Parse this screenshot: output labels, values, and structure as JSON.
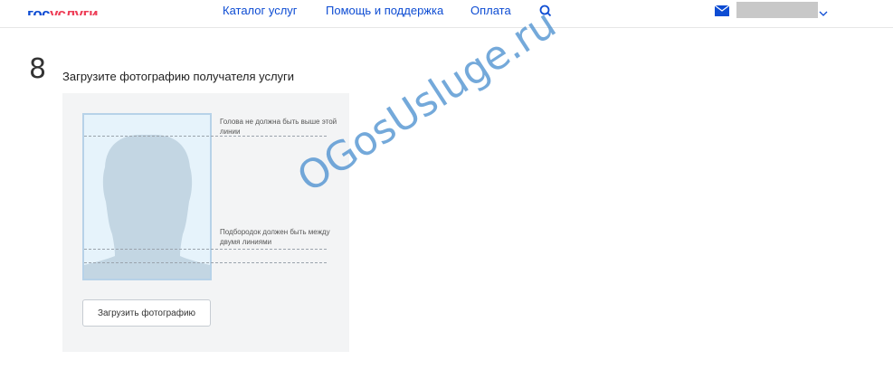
{
  "header": {
    "logo_part1": "гос",
    "logo_part2": "услуги",
    "nav": [
      "Каталог услуг",
      "Помощь и поддержка",
      "Оплата"
    ],
    "search_icon": "search-icon",
    "mail_icon": "mail-icon"
  },
  "step": {
    "number": "8",
    "title": "Загрузите фотографию получателя услуги"
  },
  "upload": {
    "hint_head": "Голова не должна быть выше этой линии",
    "hint_chin": "Подбородок должен быть между двумя линиями",
    "button_label": "Загрузить фотографию"
  },
  "watermark": "OGosUsluge.ru",
  "colors": {
    "link": "#0d4cd3",
    "logo_accent": "#ee3f58",
    "panel_bg": "#f3f4f5",
    "frame_border": "#b7d2e8",
    "silhouette": "#c3d6e3"
  }
}
